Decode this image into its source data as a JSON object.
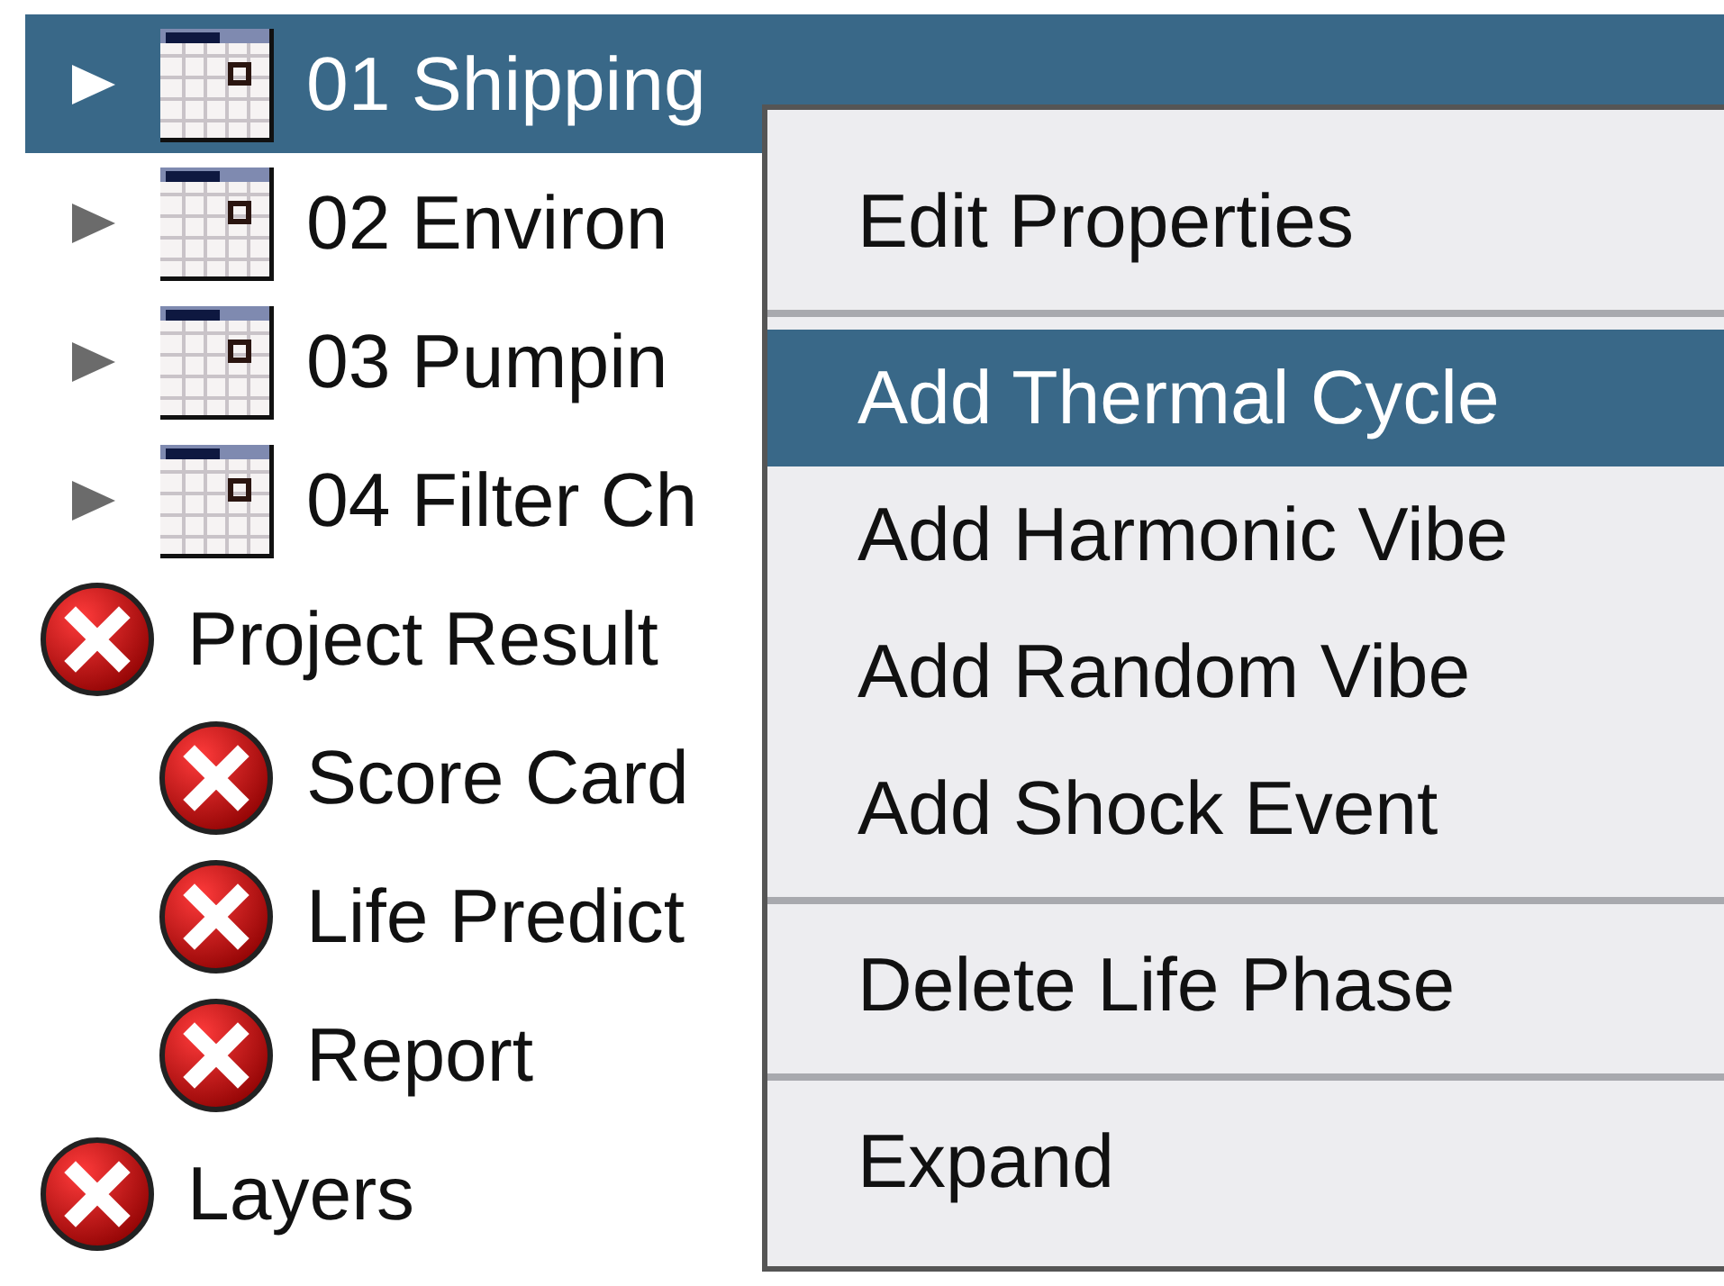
{
  "tree": [
    {
      "kind": "phase",
      "label": "01 Shipping",
      "expanded": false,
      "selected": true
    },
    {
      "kind": "phase",
      "label": "02 Environ",
      "expanded": false,
      "selected": false
    },
    {
      "kind": "phase",
      "label": "03 Pumpin",
      "expanded": false,
      "selected": false
    },
    {
      "kind": "phase",
      "label": "04 Filter Ch",
      "expanded": false,
      "selected": false
    },
    {
      "kind": "error",
      "label": "Project Result",
      "selected": false,
      "children": [
        {
          "kind": "error",
          "label": "Score Card",
          "selected": false
        },
        {
          "kind": "error",
          "label": "Life Predict",
          "selected": false
        },
        {
          "kind": "error",
          "label": "Report",
          "selected": false
        }
      ]
    },
    {
      "kind": "error",
      "label": "Layers",
      "selected": false
    }
  ],
  "context_menu": [
    {
      "kind": "item",
      "label": "Edit Properties",
      "selected": false
    },
    {
      "kind": "separator"
    },
    {
      "kind": "item",
      "label": "Add Thermal Cycle",
      "selected": true
    },
    {
      "kind": "item",
      "label": "Add Harmonic Vibe",
      "selected": false
    },
    {
      "kind": "item",
      "label": "Add Random Vibe",
      "selected": false
    },
    {
      "kind": "item",
      "label": "Add Shock Event",
      "selected": false
    },
    {
      "kind": "separator"
    },
    {
      "kind": "item",
      "label": "Delete Life Phase",
      "selected": false
    },
    {
      "kind": "separator"
    },
    {
      "kind": "item",
      "label": "Expand",
      "selected": false
    }
  ]
}
